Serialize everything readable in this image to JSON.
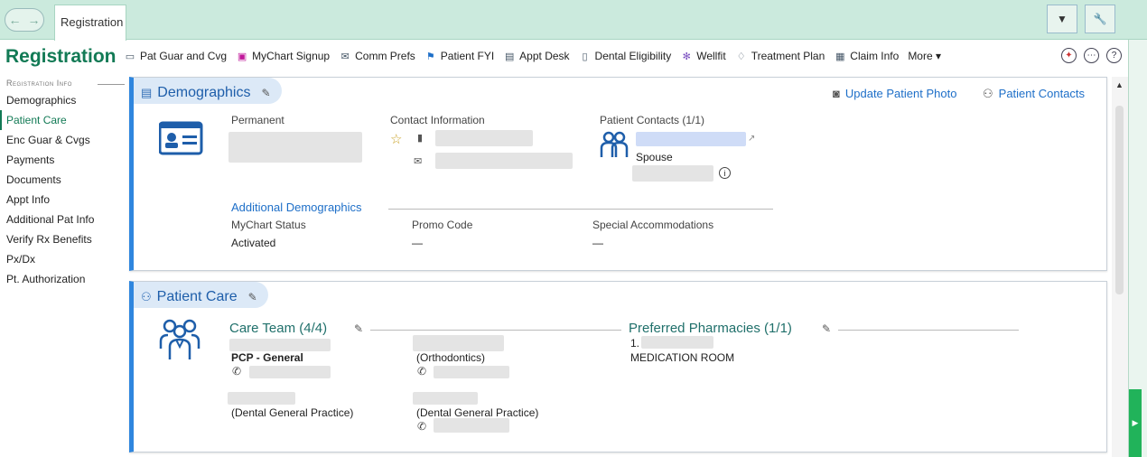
{
  "topbar": {
    "tab_label": "Registration",
    "nav_back_icon": "back-arrow-icon",
    "nav_forward_icon": "forward-arrow-icon",
    "menu_icon": "chevron-down-icon",
    "tools_icon": "wrench-icon"
  },
  "page": {
    "title": "Registration"
  },
  "sidebar": {
    "section": "Registration Info",
    "items": [
      {
        "label": "Demographics"
      },
      {
        "label": "Patient Care"
      },
      {
        "label": "Enc Guar & Cvgs"
      },
      {
        "label": "Payments"
      },
      {
        "label": "Documents"
      },
      {
        "label": "Appt Info"
      },
      {
        "label": "Additional Pat Info"
      },
      {
        "label": "Verify Rx Benefits"
      },
      {
        "label": "Px/Dx"
      },
      {
        "label": "Pt. Authorization"
      }
    ],
    "active_index": 1
  },
  "actions": [
    {
      "label": "Pat Guar and Cvg",
      "icon": "card-icon"
    },
    {
      "label": "MyChart Signup",
      "icon": "monitor-icon"
    },
    {
      "label": "Comm Prefs",
      "icon": "envelope-icon"
    },
    {
      "label": "Patient FYI",
      "icon": "flag-icon"
    },
    {
      "label": "Appt Desk",
      "icon": "desk-icon"
    },
    {
      "label": "Dental Eligibility",
      "icon": "document-icon"
    },
    {
      "label": "Wellfit",
      "icon": "dna-icon"
    },
    {
      "label": "Treatment Plan",
      "icon": "tooth-icon"
    },
    {
      "label": "Claim Info",
      "icon": "claim-icon"
    },
    {
      "label": "More ▾",
      "icon": ""
    }
  ],
  "demographics": {
    "title": "Demographics",
    "update_photo": "Update Patient Photo",
    "patient_contacts_link": "Patient Contacts",
    "permanent_label": "Permanent",
    "contact_info_label": "Contact Information",
    "patient_contacts_label": "Patient Contacts (1/1)",
    "contact_relation": "Spouse",
    "additional_demographics": "Additional Demographics",
    "mychart_status_label": "MyChart Status",
    "mychart_status_value": "Activated",
    "promo_code_label": "Promo Code",
    "promo_code_value": "—",
    "special_accommodations_label": "Special Accommodations",
    "special_accommodations_value": "—"
  },
  "patient_care": {
    "title": "Patient Care",
    "care_team_title": "Care Team (4/4)",
    "pcp_role": "PCP - General",
    "role_orthodontics": "(Orthodontics)",
    "role_dental_1": "(Dental General Practice)",
    "role_dental_2": "(Dental General Practice)",
    "pharmacies_title": "Preferred Pharmacies (1/1)",
    "pharmacy_index": "1.",
    "pharmacy_room": "MEDICATION ROOM"
  }
}
